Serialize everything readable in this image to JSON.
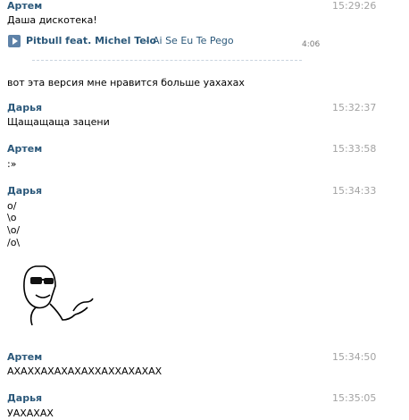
{
  "messages": [
    {
      "author": "Артем",
      "time": "15:29:26"
    },
    {
      "author": "Дарья",
      "time": "15:32:37"
    },
    {
      "author": "Артем",
      "time": "15:33:58"
    },
    {
      "author": "Дарья",
      "time": "15:34:33"
    },
    {
      "author": "Артем",
      "time": "15:34:50"
    },
    {
      "author": "Дарья",
      "time": "15:35:05"
    }
  ],
  "m1": {
    "text": "Даша дискотека!",
    "text2": "вот эта версия мне нравится больше уахахах"
  },
  "audio": {
    "artist": "Pitbull feat. Michel Telo",
    "title": "– Ai Se Eu Te Pego",
    "duration": "4:06"
  },
  "m2": {
    "text": "Щащащаща зацени"
  },
  "m3": {
    "text": ":»"
  },
  "m4": {
    "lines": [
      "o/",
      "\\o",
      "\\o/",
      "/o\\"
    ]
  },
  "m5": {
    "text": "АХАХХАХАХАХАХХАХХАХАХАХ"
  },
  "m6": {
    "text": "УАХАХАХ"
  }
}
